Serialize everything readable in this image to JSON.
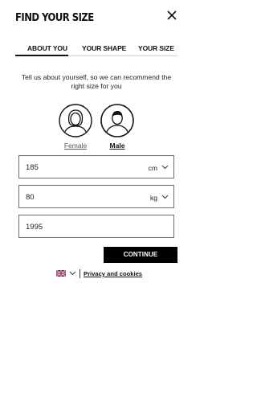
{
  "header": {
    "title": "FIND YOUR SIZE",
    "close_icon": "close-icon"
  },
  "tabs": [
    {
      "label": "ABOUT YOU",
      "active": true
    },
    {
      "label": "YOUR SHAPE",
      "active": false
    },
    {
      "label": "YOUR SIZE",
      "active": false
    }
  ],
  "intro_text": "Tell us about yourself, so we can recommend the right size for you",
  "gender": {
    "options": [
      {
        "label": "Female",
        "icon": "female-avatar-icon",
        "selected": false
      },
      {
        "label": "Male",
        "icon": "male-avatar-icon",
        "selected": true
      }
    ]
  },
  "fields": {
    "height": {
      "value": "185",
      "unit": "cm"
    },
    "weight": {
      "value": "80",
      "unit": "kg"
    },
    "birth_year": {
      "value": "1995"
    }
  },
  "cta": {
    "label": "CONTINUE"
  },
  "footer": {
    "language_icon": "uk-flag-icon",
    "privacy_label": "Privacy and cookies"
  },
  "colors": {
    "primary": "#000000",
    "background": "#ffffff",
    "border": "#6a6a6a"
  }
}
